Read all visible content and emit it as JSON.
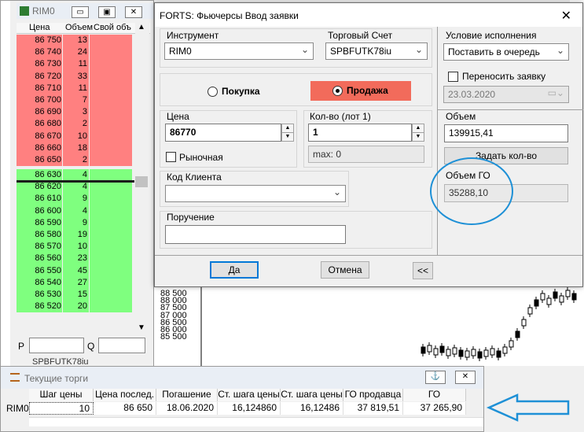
{
  "orderbook": {
    "title": "RIM0",
    "win_btns": [
      "▭",
      "▣",
      "✕"
    ],
    "headers": [
      "Цена",
      "Объем",
      "Свой объ"
    ],
    "asks": [
      {
        "price": "86 750",
        "vol": "13"
      },
      {
        "price": "86 740",
        "vol": "24"
      },
      {
        "price": "86 730",
        "vol": "11"
      },
      {
        "price": "86 720",
        "vol": "33"
      },
      {
        "price": "86 710",
        "vol": "11"
      },
      {
        "price": "86 700",
        "vol": "7"
      },
      {
        "price": "86 690",
        "vol": "3"
      },
      {
        "price": "86 680",
        "vol": "2"
      },
      {
        "price": "86 670",
        "vol": "10"
      },
      {
        "price": "86 660",
        "vol": "18"
      },
      {
        "price": "86 650",
        "vol": "2"
      }
    ],
    "bids": [
      {
        "price": "86 630",
        "vol": "4"
      },
      {
        "price": "86 620",
        "vol": "4"
      },
      {
        "price": "86 610",
        "vol": "9"
      },
      {
        "price": "86 600",
        "vol": "4"
      },
      {
        "price": "86 590",
        "vol": "9"
      },
      {
        "price": "86 580",
        "vol": "19"
      },
      {
        "price": "86 570",
        "vol": "10"
      },
      {
        "price": "86 560",
        "vol": "23"
      },
      {
        "price": "86 550",
        "vol": "45"
      },
      {
        "price": "86 540",
        "vol": "27"
      },
      {
        "price": "86 530",
        "vol": "15"
      },
      {
        "price": "86 520",
        "vol": "20"
      }
    ],
    "p_label": "P",
    "q_label": "Q",
    "account_partial": "SPBFUTK78iu"
  },
  "chart": {
    "levels": [
      "88 500",
      "88 000",
      "87 500",
      "87 000",
      "86 500",
      "86 000",
      "85 500"
    ]
  },
  "dialog": {
    "title": "FORTS: Фьючерсы Ввод заявки",
    "close": "✕",
    "instrument_label": "Инструмент",
    "instrument_value": "RIM0",
    "account_label": "Торговый Счет",
    "account_value": "SPBFUTK78iu",
    "exec_label": "Условие исполнения",
    "exec_value": "Поставить в очередь",
    "carry_label": "Переносить заявку",
    "carry_date": "23.03.2020",
    "buy_label": "Покупка",
    "sell_label": "Продажа",
    "price_label": "Цена",
    "price_value": "86770",
    "market_label": "Рыночная",
    "qty_label": "Кол-во (лот 1)",
    "qty_value": "1",
    "max_label": "max: 0",
    "volume_label": "Объем",
    "volume_value": "139915,41",
    "set_qty_label": "Задать кол-во",
    "go_label": "Объем ГО",
    "go_value": "35288,10",
    "client_label": "Код Клиента",
    "client_value": "",
    "order_label": "Поручение",
    "order_value": "",
    "ok_label": "Да",
    "cancel_label": "Отмена",
    "collapse_label": "<<",
    "colors": {
      "sell": "#f26b5b",
      "annotation": "#1e90d6"
    }
  },
  "trades": {
    "title": "Текущие торги",
    "headers": [
      "Шаг цены",
      "Цена послед.",
      "Погашение",
      "Ст. шага цены",
      "Ст. шага цены",
      "ГО продавца",
      "ГО покупателя"
    ],
    "row_label": "RIM0",
    "row": [
      "10",
      "86 650",
      "18.06.2020",
      "16,124860",
      "16,12486",
      "37 819,51",
      "37 265,90"
    ]
  }
}
